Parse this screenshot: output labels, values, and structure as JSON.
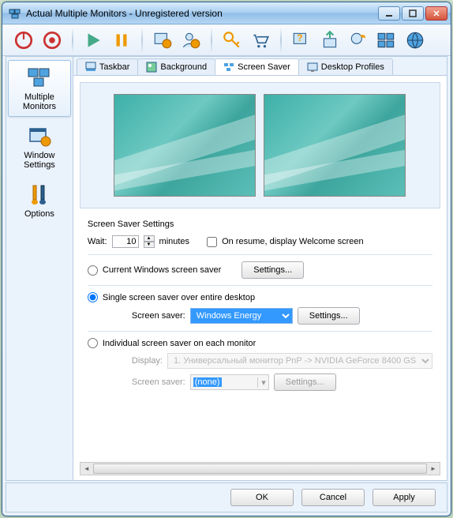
{
  "title": "Actual Multiple Monitors - Unregistered version",
  "sidebar": {
    "items": [
      {
        "label": "Multiple Monitors"
      },
      {
        "label": "Window Settings"
      },
      {
        "label": "Options"
      }
    ]
  },
  "tabs": {
    "items": [
      {
        "label": "Taskbar"
      },
      {
        "label": "Background"
      },
      {
        "label": "Screen Saver"
      },
      {
        "label": "Desktop Profiles"
      }
    ]
  },
  "settings": {
    "group_title": "Screen Saver Settings",
    "wait_label": "Wait:",
    "wait_value": "10",
    "wait_unit": "minutes",
    "resume_label": "On resume, display Welcome screen",
    "opt_current": "Current Windows screen saver",
    "opt_single": "Single screen saver over entire desktop",
    "opt_individual": "Individual screen saver on each monitor",
    "screen_saver_label": "Screen saver:",
    "screen_saver_value": "Windows Energy",
    "display_label": "Display:",
    "display_value": "1. Универсальный монитор PnP -> NVIDIA GeForce 8400 GS",
    "indiv_saver_value": "(none)",
    "settings_btn": "Settings..."
  },
  "footer": {
    "ok": "OK",
    "cancel": "Cancel",
    "apply": "Apply"
  }
}
